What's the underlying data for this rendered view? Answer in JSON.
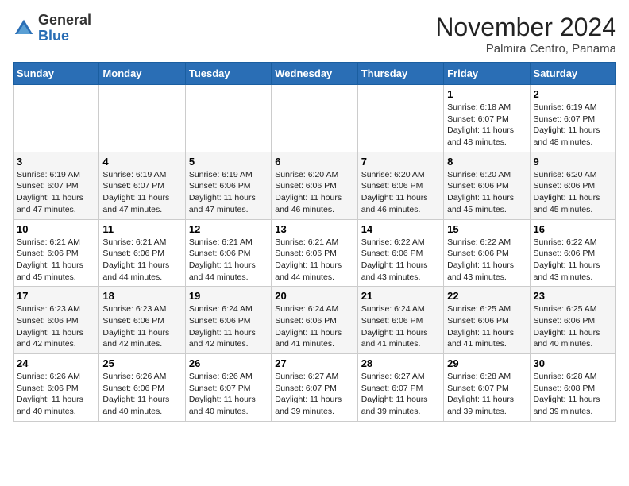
{
  "logo": {
    "general": "General",
    "blue": "Blue"
  },
  "title": "November 2024",
  "location": "Palmira Centro, Panama",
  "days_of_week": [
    "Sunday",
    "Monday",
    "Tuesday",
    "Wednesday",
    "Thursday",
    "Friday",
    "Saturday"
  ],
  "weeks": [
    [
      {
        "day": "",
        "info": ""
      },
      {
        "day": "",
        "info": ""
      },
      {
        "day": "",
        "info": ""
      },
      {
        "day": "",
        "info": ""
      },
      {
        "day": "",
        "info": ""
      },
      {
        "day": "1",
        "info": "Sunrise: 6:18 AM\nSunset: 6:07 PM\nDaylight: 11 hours and 48 minutes."
      },
      {
        "day": "2",
        "info": "Sunrise: 6:19 AM\nSunset: 6:07 PM\nDaylight: 11 hours and 48 minutes."
      }
    ],
    [
      {
        "day": "3",
        "info": "Sunrise: 6:19 AM\nSunset: 6:07 PM\nDaylight: 11 hours and 47 minutes."
      },
      {
        "day": "4",
        "info": "Sunrise: 6:19 AM\nSunset: 6:07 PM\nDaylight: 11 hours and 47 minutes."
      },
      {
        "day": "5",
        "info": "Sunrise: 6:19 AM\nSunset: 6:06 PM\nDaylight: 11 hours and 47 minutes."
      },
      {
        "day": "6",
        "info": "Sunrise: 6:20 AM\nSunset: 6:06 PM\nDaylight: 11 hours and 46 minutes."
      },
      {
        "day": "7",
        "info": "Sunrise: 6:20 AM\nSunset: 6:06 PM\nDaylight: 11 hours and 46 minutes."
      },
      {
        "day": "8",
        "info": "Sunrise: 6:20 AM\nSunset: 6:06 PM\nDaylight: 11 hours and 45 minutes."
      },
      {
        "day": "9",
        "info": "Sunrise: 6:20 AM\nSunset: 6:06 PM\nDaylight: 11 hours and 45 minutes."
      }
    ],
    [
      {
        "day": "10",
        "info": "Sunrise: 6:21 AM\nSunset: 6:06 PM\nDaylight: 11 hours and 45 minutes."
      },
      {
        "day": "11",
        "info": "Sunrise: 6:21 AM\nSunset: 6:06 PM\nDaylight: 11 hours and 44 minutes."
      },
      {
        "day": "12",
        "info": "Sunrise: 6:21 AM\nSunset: 6:06 PM\nDaylight: 11 hours and 44 minutes."
      },
      {
        "day": "13",
        "info": "Sunrise: 6:21 AM\nSunset: 6:06 PM\nDaylight: 11 hours and 44 minutes."
      },
      {
        "day": "14",
        "info": "Sunrise: 6:22 AM\nSunset: 6:06 PM\nDaylight: 11 hours and 43 minutes."
      },
      {
        "day": "15",
        "info": "Sunrise: 6:22 AM\nSunset: 6:06 PM\nDaylight: 11 hours and 43 minutes."
      },
      {
        "day": "16",
        "info": "Sunrise: 6:22 AM\nSunset: 6:06 PM\nDaylight: 11 hours and 43 minutes."
      }
    ],
    [
      {
        "day": "17",
        "info": "Sunrise: 6:23 AM\nSunset: 6:06 PM\nDaylight: 11 hours and 42 minutes."
      },
      {
        "day": "18",
        "info": "Sunrise: 6:23 AM\nSunset: 6:06 PM\nDaylight: 11 hours and 42 minutes."
      },
      {
        "day": "19",
        "info": "Sunrise: 6:24 AM\nSunset: 6:06 PM\nDaylight: 11 hours and 42 minutes."
      },
      {
        "day": "20",
        "info": "Sunrise: 6:24 AM\nSunset: 6:06 PM\nDaylight: 11 hours and 41 minutes."
      },
      {
        "day": "21",
        "info": "Sunrise: 6:24 AM\nSunset: 6:06 PM\nDaylight: 11 hours and 41 minutes."
      },
      {
        "day": "22",
        "info": "Sunrise: 6:25 AM\nSunset: 6:06 PM\nDaylight: 11 hours and 41 minutes."
      },
      {
        "day": "23",
        "info": "Sunrise: 6:25 AM\nSunset: 6:06 PM\nDaylight: 11 hours and 40 minutes."
      }
    ],
    [
      {
        "day": "24",
        "info": "Sunrise: 6:26 AM\nSunset: 6:06 PM\nDaylight: 11 hours and 40 minutes."
      },
      {
        "day": "25",
        "info": "Sunrise: 6:26 AM\nSunset: 6:06 PM\nDaylight: 11 hours and 40 minutes."
      },
      {
        "day": "26",
        "info": "Sunrise: 6:26 AM\nSunset: 6:07 PM\nDaylight: 11 hours and 40 minutes."
      },
      {
        "day": "27",
        "info": "Sunrise: 6:27 AM\nSunset: 6:07 PM\nDaylight: 11 hours and 39 minutes."
      },
      {
        "day": "28",
        "info": "Sunrise: 6:27 AM\nSunset: 6:07 PM\nDaylight: 11 hours and 39 minutes."
      },
      {
        "day": "29",
        "info": "Sunrise: 6:28 AM\nSunset: 6:07 PM\nDaylight: 11 hours and 39 minutes."
      },
      {
        "day": "30",
        "info": "Sunrise: 6:28 AM\nSunset: 6:08 PM\nDaylight: 11 hours and 39 minutes."
      }
    ]
  ]
}
